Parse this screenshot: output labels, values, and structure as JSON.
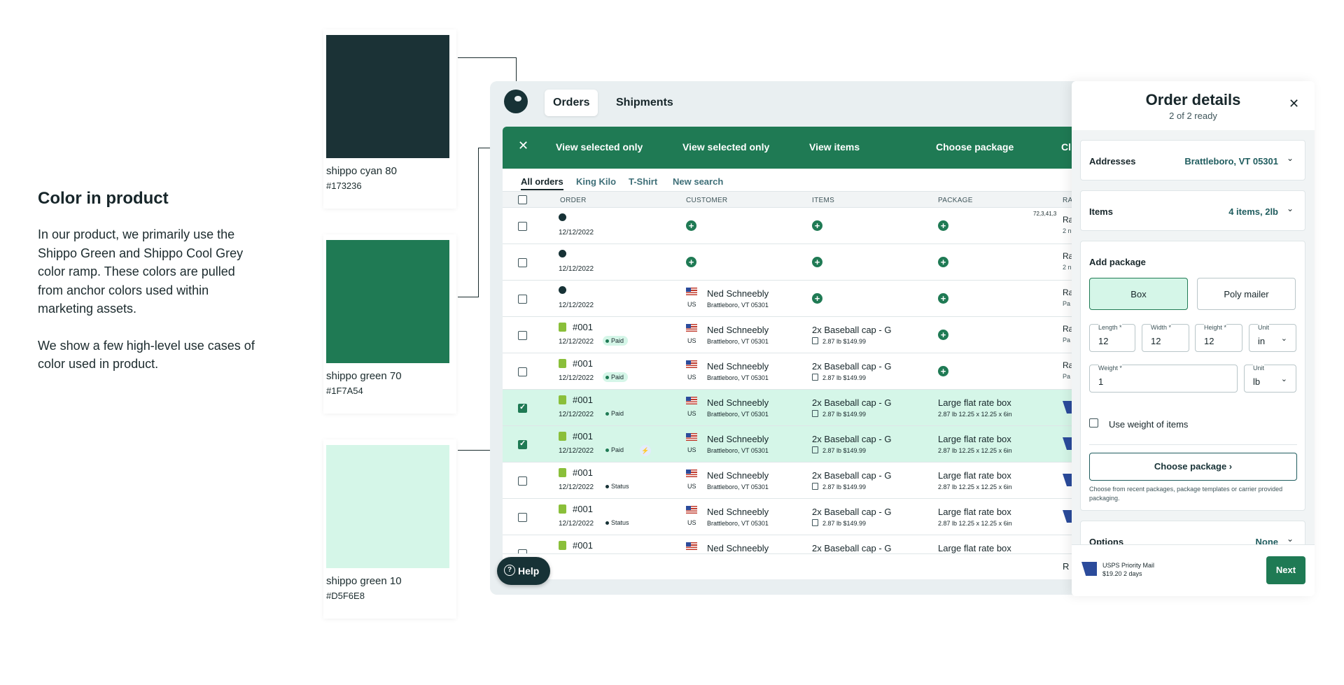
{
  "intro": {
    "title": "Color in product",
    "para1": "In our product, we primarily use the Shippo Green and Shippo Cool Grey color ramp. These colors are pulled from anchor colors used within marketing assets.",
    "para2": "We show a few high-level use cases of color used in product."
  },
  "swatches": [
    {
      "name": "shippo cyan 80",
      "hex": "#173236",
      "color": "#1b3236"
    },
    {
      "name": "shippo green 70",
      "hex": "#1F7A54",
      "color": "#1f7a54"
    },
    {
      "name": "shippo green 10",
      "hex": "#D5F6E8",
      "color": "#d5f6e8"
    }
  ],
  "app": {
    "tabs": [
      "Orders",
      "Shipments"
    ],
    "actions": {
      "close": "✕",
      "a1": "View selected only",
      "a2": "View selected only",
      "a3": "View items",
      "a4": "Choose package",
      "a5": "Cl"
    },
    "filters": [
      "All orders",
      "King Kilo",
      "T-Shirt",
      "New search"
    ],
    "columns": {
      "order": "ORDER",
      "customer": "CUSTOMER",
      "items": "ITEMS",
      "package": "PACKAGE",
      "rate": "RA"
    },
    "rows": [
      {
        "order": "",
        "date": "12/12/2022",
        "customer": "",
        "addr": "",
        "items": "",
        "items_meta": "",
        "pkg": "",
        "pkg_meta": "",
        "rate": "Ra",
        "rate_sub": "2 n",
        "extra": "72,3,41,3",
        "selected": false
      },
      {
        "order": "",
        "date": "12/12/2022",
        "customer": "",
        "addr": "",
        "items": "",
        "items_meta": "",
        "pkg": "",
        "pkg_meta": "",
        "rate": "Ra",
        "rate_sub": "2 n",
        "selected": false
      },
      {
        "order": "",
        "date": "12/12/2022",
        "customer": "Ned Schneebly",
        "addr": "Brattleboro, VT 05301",
        "country": "US",
        "items": "",
        "items_meta": "",
        "pkg": "",
        "pkg_meta": "",
        "rate": "Ra",
        "rate_sub": "Pa",
        "selected": false
      },
      {
        "order": "#001",
        "date": "12/12/2022",
        "badge": "Paid",
        "customer": "Ned Schneebly",
        "addr": "Brattleboro, VT 05301",
        "country": "US",
        "items": "2x Baseball cap - G",
        "items_meta": "2.87 lb $149.99",
        "pkg": "",
        "pkg_meta": "",
        "rate": "Ra",
        "rate_sub": "Pa",
        "selected": false
      },
      {
        "order": "#001",
        "date": "12/12/2022",
        "badge": "Paid",
        "customer": "Ned Schneebly",
        "addr": "Brattleboro, VT 05301",
        "country": "US",
        "items": "2x Baseball cap - G",
        "items_meta": "2.87 lb $149.99",
        "pkg": "",
        "pkg_meta": "",
        "rate": "Ra",
        "rate_sub": "Pa",
        "selected": false
      },
      {
        "order": "#001",
        "date": "12/12/2022",
        "badge": "Paid",
        "customer": "Ned Schneebly",
        "addr": "Brattleboro, VT 05301",
        "country": "US",
        "items": "2x Baseball cap - G",
        "items_meta": "2.87 lb $149.99",
        "pkg": "Large flat rate box",
        "pkg_meta": "2.87 lb 12.25 x 12.25 x 6in",
        "selected": true
      },
      {
        "order": "#001",
        "date": "12/12/2022",
        "badge": "Paid",
        "customer": "Ned Schneebly",
        "addr": "Brattleboro, VT 05301",
        "country": "US",
        "items": "2x Baseball cap - G",
        "items_meta": "2.87 lb $149.99",
        "pkg": "Large flat rate box",
        "pkg_meta": "2.87 lb 12.25 x 12.25 x 6in",
        "selected": true,
        "bolt": "⚡"
      },
      {
        "order": "#001",
        "date": "12/12/2022",
        "badge": "Status",
        "customer": "Ned Schneebly",
        "addr": "Brattleboro, VT 05301",
        "country": "US",
        "items": "2x Baseball cap - G",
        "items_meta": "2.87 lb $149.99",
        "pkg": "Large flat rate box",
        "pkg_meta": "2.87 lb 12.25 x 12.25 x 6in",
        "selected": false
      },
      {
        "order": "#001",
        "date": "12/12/2022",
        "badge": "Status",
        "customer": "Ned Schneebly",
        "addr": "Brattleboro, VT 05301",
        "country": "US",
        "items": "2x Baseball cap - G",
        "items_meta": "2.87 lb $149.99",
        "pkg": "Large flat rate box",
        "pkg_meta": "2.87 lb 12.25 x 12.25 x 6in",
        "selected": false
      },
      {
        "order": "#001",
        "date": "",
        "customer": "Ned Schneebly",
        "addr": "",
        "items": "2x Baseball cap - G",
        "items_meta": "",
        "pkg": "Large flat rate box",
        "pkg_meta": "",
        "selected": false
      }
    ],
    "help": "Help",
    "footer_right": "R"
  },
  "drawer": {
    "title": "Order details",
    "subtitle": "2 of 2 ready",
    "close": "✕",
    "addresses_label": "Addresses",
    "addresses_value": "Brattleboro, VT 05301",
    "items_label": "Items",
    "items_value": "4 items, 2lb",
    "add_package": "Add package",
    "seg_box": "Box",
    "seg_poly": "Poly mailer",
    "length_label": "Length *",
    "length_value": "12",
    "width_label": "Width *",
    "width_value": "12",
    "height_label": "Height *",
    "height_value": "12",
    "unit_label": "Unit",
    "unit_value": "in",
    "weight_label": "Weight *",
    "weight_value": "1",
    "wunit_label": "Unit",
    "wunit_value": "lb",
    "use_weight": "Use weight of items",
    "choose_package": "Choose package  ›",
    "choose_help": "Choose from recent packages, package templates or carrier provided packaging.",
    "options_label": "Options",
    "options_value": "None",
    "service": "USPS Priority Mail",
    "service_price": "$19.20  2 days",
    "next": "Next",
    "chevron": "⌄"
  }
}
